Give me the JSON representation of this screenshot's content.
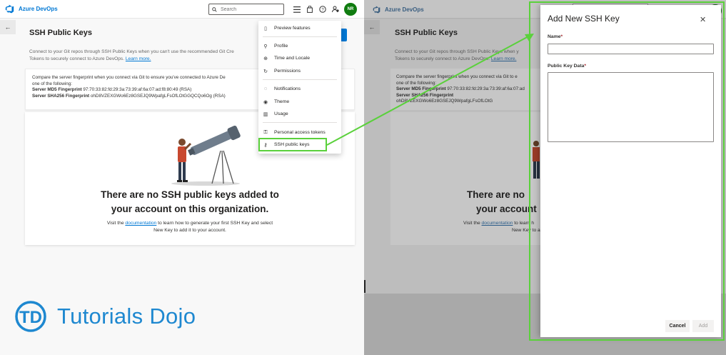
{
  "left": {
    "app_name": "Azure DevOps",
    "search_placeholder": "Search",
    "avatar_initials": "NR",
    "page_title": "SSH Public Keys",
    "description_line1": "Connect to your Git repos through SSH Public Keys when you can't use the recommended Git Cre",
    "description_line2_prefix": "Tokens to securely connect to Azure DevOps. ",
    "learn_more": "Learn more.",
    "fingerprint": {
      "intro_line1": "Compare the server fingerprint when you connect via Git to ensure you've connected to Azure De",
      "intro_line2": "one of the following:",
      "md5_label": "Server MD5 Fingerprint",
      "md5_value": "97:70:33:82:fd:29:3a:73:39:af:6a:07:ad:f8:80:49 (RSA)",
      "sha_label": "Server SHA256 Fingerprint",
      "sha_value": "ohD8VZEXGWo6Ez8GSEJQ9WpafgLFsOfLOtGGQCQo6Og (RSA)"
    },
    "empty_title_line1": "There are no SSH public keys added to",
    "empty_title_line2": "your account on this organization.",
    "empty_sub_prefix": "Visit the ",
    "empty_sub_link": "documentation",
    "empty_sub_suffix1": " to learn how to generate your first SSH Key and select",
    "empty_sub_line2": "New Key to add it to your account.",
    "menu": [
      {
        "label": "Preview features",
        "icon": "page-icon"
      },
      {
        "label": "Profile",
        "icon": "link-icon"
      },
      {
        "label": "Time and Locale",
        "icon": "globe-icon"
      },
      {
        "label": "Permissions",
        "icon": "refresh-icon"
      },
      {
        "label": "Notifications",
        "icon": "chat-icon"
      },
      {
        "label": "Theme",
        "icon": "eye-icon"
      },
      {
        "label": "Usage",
        "icon": "bar-chart-icon"
      },
      {
        "label": "Personal access tokens",
        "icon": "tokens-icon"
      },
      {
        "label": "SSH public keys",
        "icon": "key-icon"
      }
    ]
  },
  "right": {
    "app_name": "Azure DevOps",
    "page_title": "SSH Public Keys",
    "description_line1": "Connect to your Git repos through SSH Public Keys when y",
    "description_line2_prefix": "Tokens to securely connect to Azure DevOps. ",
    "learn_more": "Learn more.",
    "fingerprint": {
      "intro_line1": "Compare the server fingerprint when you connect via Git to e",
      "intro_line2": "one of the following:",
      "md5_label": "Server MD5 Fingerprint",
      "md5_value": "97:70:33:82:fd:29:3a:73:39:af:6a:07:ad",
      "sha_label": "Server SHA256 Fingerprint",
      "sha_value": "ohD8VZEXGWo6Ez8GSEJQ9WpafgLFsOfLOtG"
    },
    "empty_title_line1": "There are no",
    "empty_title_line2": "your account",
    "empty_sub_prefix": "Visit the ",
    "empty_sub_link": "documentation",
    "empty_sub_suffix": " to learn h",
    "empty_sub_line2": "New Key to a",
    "dialog": {
      "title": "Add New SSH Key",
      "name_label": "Name",
      "name_value": "",
      "key_label": "Public Key Data",
      "key_value": "",
      "required_mark": "*",
      "cancel": "Cancel",
      "add": "Add"
    }
  },
  "watermark": "Tutorials Dojo",
  "watermark_badge": "TD",
  "colors": {
    "accent": "#0078d4",
    "highlight": "#5ad13b",
    "avatar": "#107c10",
    "watermark": "#1e88d0"
  }
}
